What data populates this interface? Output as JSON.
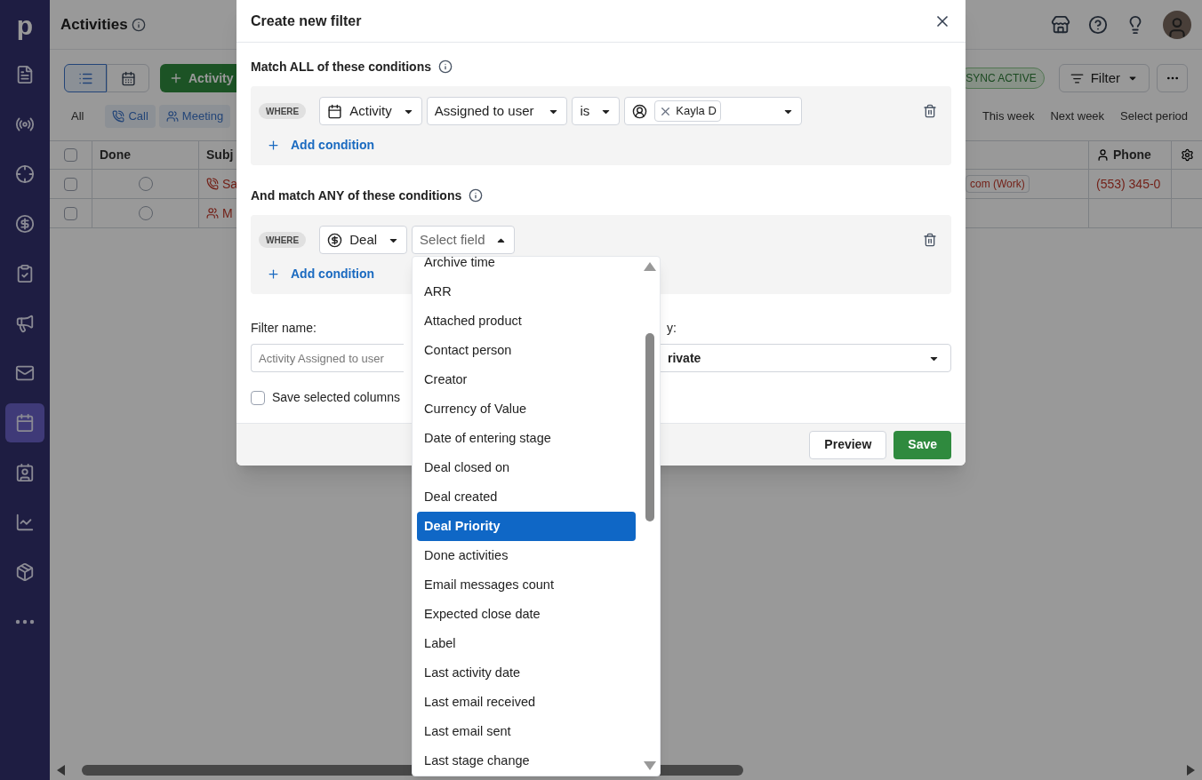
{
  "sidebar": {
    "logo": "p",
    "items": [
      {
        "kind": "leads",
        "selected": false
      },
      {
        "kind": "radio",
        "selected": false
      },
      {
        "kind": "target",
        "selected": false
      },
      {
        "kind": "deals",
        "selected": false
      },
      {
        "kind": "tasks",
        "selected": false
      },
      {
        "kind": "campaigns",
        "selected": false
      },
      {
        "kind": "mail",
        "selected": false
      },
      {
        "kind": "calendar",
        "selected": true
      },
      {
        "kind": "contacts",
        "selected": false
      },
      {
        "kind": "insights",
        "selected": false
      },
      {
        "kind": "products",
        "selected": false
      },
      {
        "kind": "more",
        "selected": false
      }
    ]
  },
  "header": {
    "title": "Activities"
  },
  "toolbar": {
    "views": [
      {
        "kind": "list",
        "selected": true
      },
      {
        "kind": "calendar",
        "selected": false
      }
    ],
    "add_button": "Activity",
    "sync_badge": "SYNC ACTIVE",
    "filter_button": "Filter"
  },
  "type_filters": [
    {
      "label": "All",
      "kind": "all"
    },
    {
      "label": "Call",
      "kind": "call"
    },
    {
      "label": "Meeting",
      "kind": "meeting"
    }
  ],
  "periods": [
    "This week",
    "Next week",
    "Select period"
  ],
  "table": {
    "all_checked": false,
    "columns": [
      "Done",
      "Subj",
      "Phone"
    ],
    "rows": [
      {
        "checked": false,
        "done": false,
        "kind": "call",
        "subject": "Sa",
        "email": "com (Work)",
        "phone": "(553) 345-0"
      },
      {
        "checked": false,
        "done": false,
        "kind": "meeting",
        "subject": "M"
      }
    ]
  },
  "dialog": {
    "title": "Create new filter",
    "all_section": {
      "title": "Match ALL of these conditions",
      "add": "Add condition",
      "conditions": [
        {
          "where": "WHERE",
          "entity": {
            "kind": "activity",
            "label": "Activity"
          },
          "field": "Assigned to user",
          "operator": "is",
          "value": "Kayla D"
        }
      ]
    },
    "any_section": {
      "title": "And match ANY of these conditions",
      "add": "Add condition",
      "conditions": [
        {
          "where": "WHERE",
          "entity": {
            "kind": "deal",
            "label": "Deal"
          },
          "field_placeholder": "Select field",
          "open": true
        }
      ]
    },
    "filter_name": {
      "label": "Filter name:",
      "placeholder": "Activity Assigned to user"
    },
    "visibility": {
      "label": "y:",
      "value": "rivate"
    },
    "save_columns": {
      "label": "Save selected columns",
      "checked": false
    },
    "buttons": {
      "preview": "Preview",
      "save": "Save"
    }
  },
  "field_menu": {
    "items": [
      {
        "label": "Archive time",
        "selected": false
      },
      {
        "label": "ARR",
        "selected": false
      },
      {
        "label": "Attached product",
        "selected": false
      },
      {
        "label": "Contact person",
        "selected": false
      },
      {
        "label": "Creator",
        "selected": false
      },
      {
        "label": "Currency of Value",
        "selected": false
      },
      {
        "label": "Date of entering stage",
        "selected": false
      },
      {
        "label": "Deal closed on",
        "selected": false
      },
      {
        "label": "Deal created",
        "selected": false
      },
      {
        "label": "Deal Priority",
        "selected": true
      },
      {
        "label": "Done activities",
        "selected": false
      },
      {
        "label": "Email messages count",
        "selected": false
      },
      {
        "label": "Expected close date",
        "selected": false
      },
      {
        "label": "Label",
        "selected": false
      },
      {
        "label": "Last activity date",
        "selected": false
      },
      {
        "label": "Last email received",
        "selected": false
      },
      {
        "label": "Last email sent",
        "selected": false
      },
      {
        "label": "Last stage change",
        "selected": false
      }
    ]
  }
}
